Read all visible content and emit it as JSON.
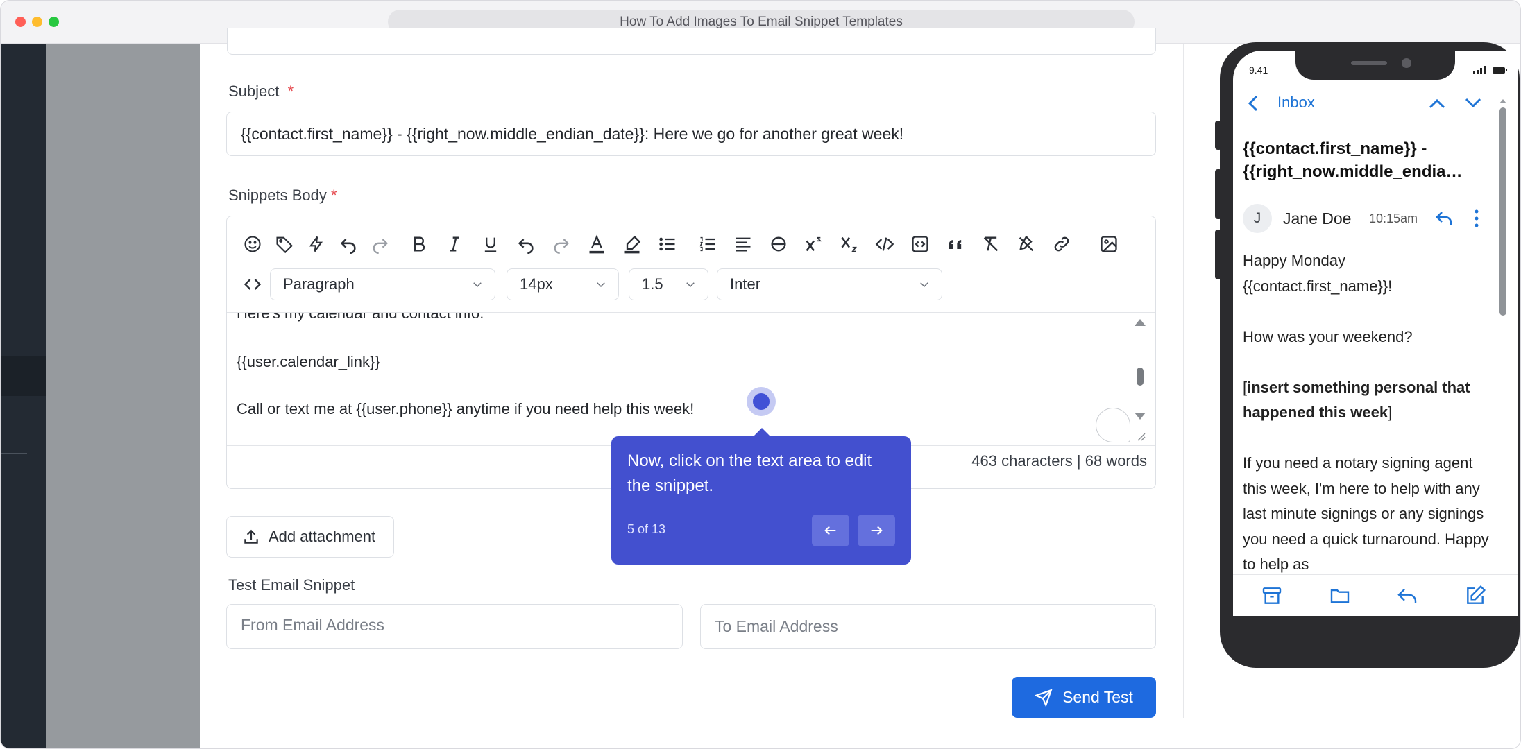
{
  "window": {
    "title": "How To Add Images To Email Snippet Templates"
  },
  "form": {
    "subject_label": "Subject",
    "required_mark": "*",
    "subject_value": "{{contact.first_name}} - {{right_now.middle_endian_date}}: Here we go for another great week!",
    "snippets_body_label": "Snippets Body",
    "toolbar": {
      "paragraph_select": "Paragraph",
      "font_size_select": "14px",
      "line_height_select": "1.5",
      "font_family_select": "Inter"
    },
    "body_lines": {
      "partial_top": "Here's my calendar and contact info:",
      "calendar_link": "{{user.calendar_link}}",
      "call_text": "Call or text me at {{user.phone}} anytime if you need help this week!"
    },
    "counter": "463 characters | 68 words",
    "add_attachment_label": "Add attachment",
    "test_email_label": "Test Email Snippet",
    "from_placeholder": "From Email Address",
    "to_placeholder": "To Email Address",
    "send_test_label": "Send Test"
  },
  "tooltip": {
    "text": "Now, click on the text area to edit the snippet.",
    "step": "5 of 13"
  },
  "phone": {
    "time": "9.41",
    "back_label": "Inbox",
    "subject_line1": "{{contact.first_name}} -",
    "subject_line2": "{{right_now.middle_endia…",
    "avatar_initial": "J",
    "sender_name": "Jane Doe",
    "sent_time": "10:15am",
    "body": {
      "greeting_line1": "Happy Monday",
      "greeting_line2": "{{contact.first_name}}!",
      "question": "How was your weekend?",
      "bracket_open": "[",
      "insert_bold": "insert something personal that happened this week",
      "bracket_close": "]",
      "paragraph": "If you need a notary signing agent this week, I'm here to help with any last minute signings or any signings you need a quick turnaround. Happy to help as"
    }
  },
  "colors": {
    "accent": "#4350cf",
    "send_button": "#1e6ae0",
    "link_blue": "#1e74d6",
    "required": "#e5484d"
  }
}
